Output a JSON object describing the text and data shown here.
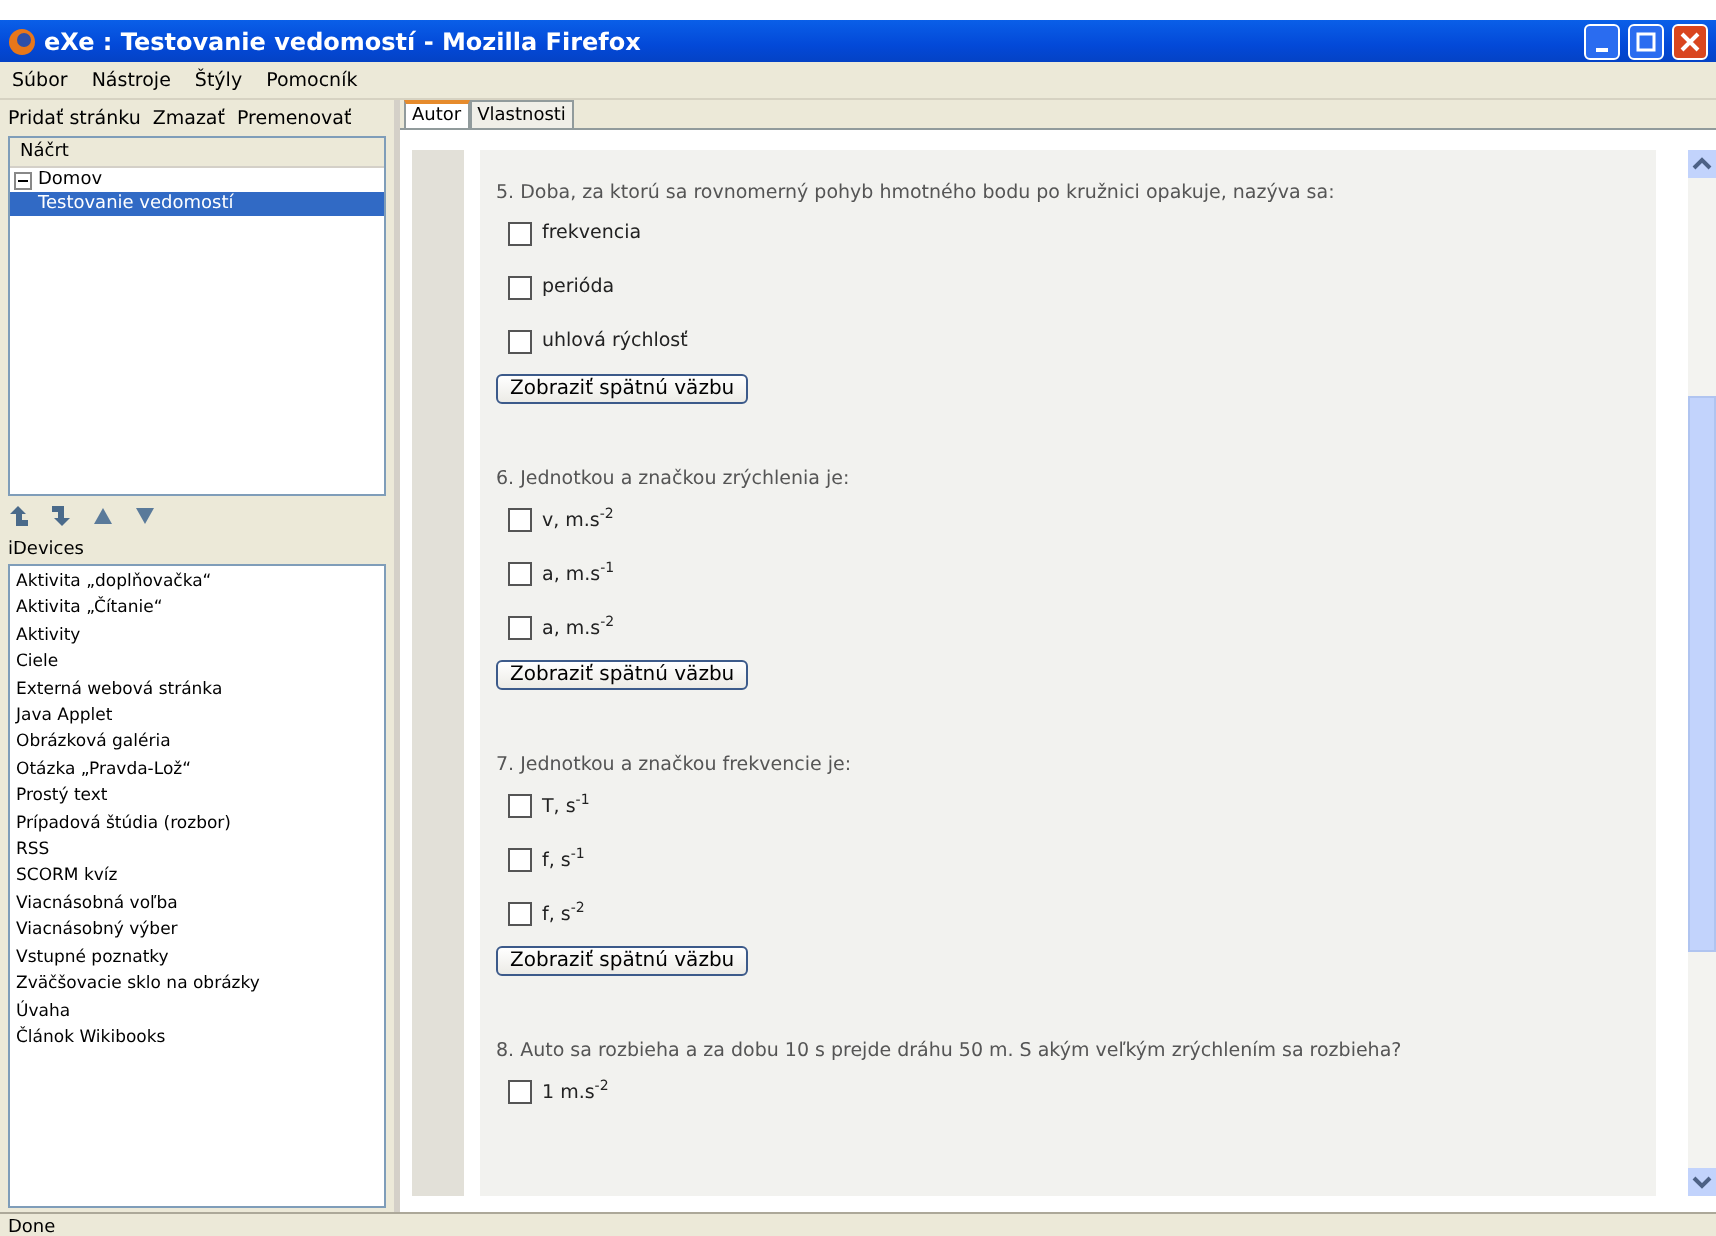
{
  "window": {
    "title": "eXe : Testovanie vedomostí - Mozilla Firefox"
  },
  "menu": [
    "Súbor",
    "Nástroje",
    "Štýly",
    "Pomocník"
  ],
  "toolbar": [
    "Pridať stránku",
    "Zmazať",
    "Premenovať"
  ],
  "outline": {
    "header": "Náčrt",
    "tree": [
      {
        "label": "Domov",
        "expanded": true,
        "selected": false,
        "children": [
          {
            "label": "Testovanie vedomostí",
            "selected": true
          }
        ]
      }
    ]
  },
  "idevices": {
    "header": "iDevices",
    "items": [
      "Aktivita „doplňovačka“",
      "Aktivita „Čítanie“",
      "Aktivity",
      "Ciele",
      "Externá webová stránka",
      "Java Applet",
      "Obrázková galéria",
      "Otázka „Pravda-Lož“",
      "Prostý text",
      "Prípadová štúdia (rozbor)",
      "RSS",
      "SCORM kvíz",
      "Viacnásobná voľba",
      "Viacnásobný výber",
      "Vstupné poznatky",
      "Zväčšovacie sklo na obrázky",
      "Úvaha",
      "Článok Wikibooks"
    ]
  },
  "tabs": [
    {
      "label": "Autor",
      "selected": true
    },
    {
      "label": "Vlastnosti",
      "selected": false
    }
  ],
  "questions": [
    {
      "text": "5. Doba, za ktorú sa rovnomerný pohyb hmotného bodu po kružnici opakuje, nazýva sa:",
      "options": [
        {
          "label": "frekvencia",
          "checked": false
        },
        {
          "label": "perióda",
          "checked": false
        },
        {
          "label": "uhlová rýchlosť",
          "checked": false
        }
      ],
      "button": "Zobraziť spätnú väzbu"
    },
    {
      "text": "6. Jednotkou a značkou zrýchlenia je:",
      "options": [
        {
          "label": "v, m.s$^{-2}$",
          "checked": false
        },
        {
          "label": "a, m.s$^{-1}$",
          "checked": false
        },
        {
          "label": "a, m.s$^{-2}$",
          "checked": false
        }
      ],
      "button": "Zobraziť spätnú väzbu"
    },
    {
      "text": "7. Jednotkou a značkou frekvencie je:",
      "options": [
        {
          "label": "T, s$^{-1}$",
          "checked": false
        },
        {
          "label": "f, s$^{-1}$",
          "checked": false
        },
        {
          "label": "f, s$^{-2}$",
          "checked": false
        }
      ],
      "button": "Zobraziť spätnú väzbu"
    },
    {
      "text": "8. Auto sa rozbieha a za dobu 10 s prejde dráhu 50 m. S akým veľkým zrýchlením sa rozbieha?",
      "options": [
        {
          "label": "1 m.s$^{-2}$",
          "checked": false
        }
      ]
    }
  ],
  "status_bar": "Done"
}
